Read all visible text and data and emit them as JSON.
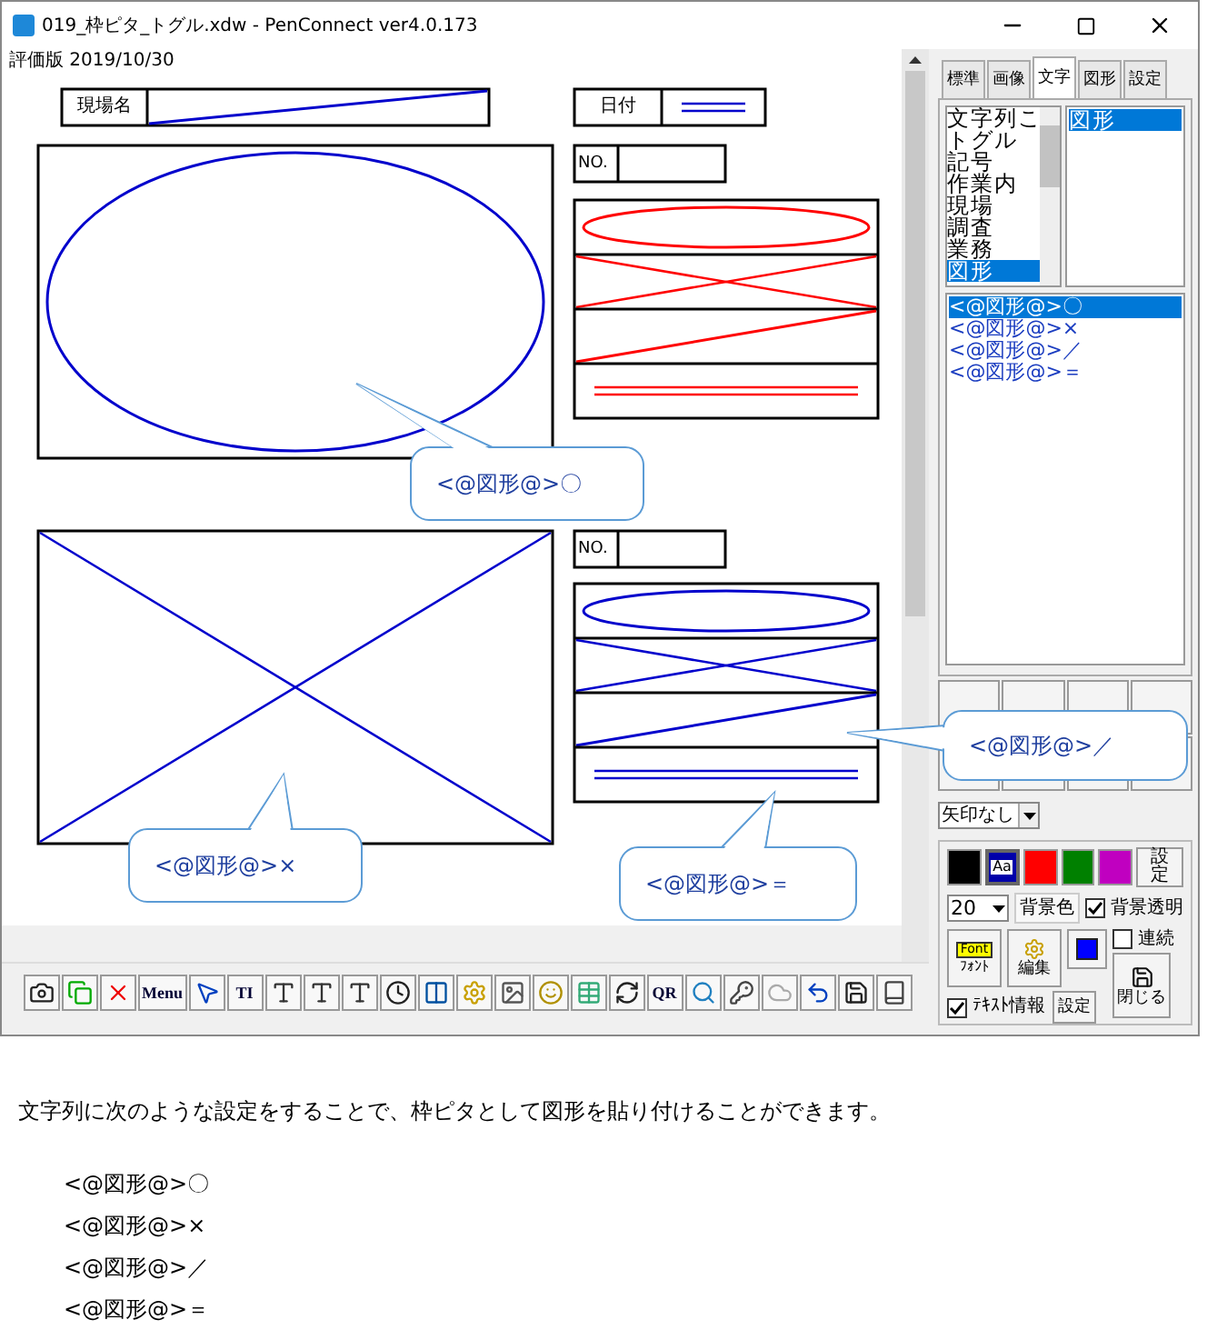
{
  "window": {
    "title": "019_枠ピタ_トグル.xdw - PenConnect ver4.0.173",
    "subtitle": "評価版 2019/10/30"
  },
  "canvas": {
    "header_fields": [
      {
        "label": "現場名",
        "kind": "slash"
      },
      {
        "label": "日付",
        "kind": "double"
      }
    ],
    "blocks": [
      {
        "main": {
          "kind": "ellipse"
        },
        "no_label": "NO.",
        "color": "#ff0000",
        "stack": [
          {
            "kind": "ellipse"
          },
          {
            "kind": "cross"
          },
          {
            "kind": "slash"
          },
          {
            "kind": "double"
          }
        ]
      },
      {
        "main": {
          "kind": "cross"
        },
        "no_label": "NO.",
        "color": "#0000cc",
        "stack": [
          {
            "kind": "ellipse"
          },
          {
            "kind": "cross"
          },
          {
            "kind": "slash"
          },
          {
            "kind": "double"
          }
        ]
      }
    ]
  },
  "callouts": [
    {
      "text": "<@図形@>〇"
    },
    {
      "text": "<@図形@>×"
    },
    {
      "text": "<@図形@>＝"
    },
    {
      "text": "<@図形@>／"
    }
  ],
  "panel": {
    "tabs": [
      {
        "label": "標準",
        "selected": false
      },
      {
        "label": "画像",
        "selected": false
      },
      {
        "label": "文字",
        "selected": true
      },
      {
        "label": "図形",
        "selected": false
      },
      {
        "label": "設定",
        "selected": false
      }
    ],
    "categories": [
      {
        "label": "文字列こ",
        "selected": false
      },
      {
        "label": "トグル",
        "selected": false
      },
      {
        "label": "記号",
        "selected": false
      },
      {
        "label": "作業内",
        "selected": false
      },
      {
        "label": "現場",
        "selected": false
      },
      {
        "label": "調査",
        "selected": false
      },
      {
        "label": "業務",
        "selected": false
      },
      {
        "label": "図形",
        "selected": true
      }
    ],
    "subcategories": [
      {
        "label": "図形",
        "selected": true
      }
    ],
    "entries": [
      {
        "label": "<@図形@>〇",
        "selected": true
      },
      {
        "label": "<@図形@>×",
        "selected": false
      },
      {
        "label": "<@図形@>／",
        "selected": false
      },
      {
        "label": "<@図形@>＝",
        "selected": false
      }
    ],
    "arrow_select": "矢印なし",
    "swatches": [
      {
        "color": "#000000",
        "selected": false
      },
      {
        "color": "#0000aa",
        "label": "Aa",
        "selected": true
      },
      {
        "color": "#ff0000",
        "selected": false
      },
      {
        "color": "#008000",
        "selected": false
      },
      {
        "color": "#c000c0",
        "selected": false
      }
    ],
    "swatch_button": "設定",
    "size": "20",
    "bg_button": "背景色",
    "bg_transparent": {
      "label": "背景透明",
      "checked": true
    },
    "continuous": {
      "label": "連続",
      "checked": false
    },
    "font_button": {
      "badge": "Font",
      "label": "ﾌｫﾝﾄ"
    },
    "edit_button": "編集",
    "set_button": "設定",
    "close_button": "閉じる",
    "text_info": {
      "label": "ﾃｷｽﾄ情報",
      "checked": true
    }
  },
  "toolbar": [
    {
      "kind": "camera"
    },
    {
      "kind": "frames"
    },
    {
      "kind": "delete"
    },
    {
      "kind": "text",
      "label": "Menu"
    },
    {
      "kind": "cursor"
    },
    {
      "kind": "text",
      "label": "TI"
    },
    {
      "kind": "type"
    },
    {
      "kind": "type"
    },
    {
      "kind": "type"
    },
    {
      "kind": "clock"
    },
    {
      "kind": "columns"
    },
    {
      "kind": "gear"
    },
    {
      "kind": "image"
    },
    {
      "kind": "smile"
    },
    {
      "kind": "table"
    },
    {
      "kind": "rotate"
    },
    {
      "kind": "text",
      "label": "QR"
    },
    {
      "kind": "search"
    },
    {
      "kind": "key"
    },
    {
      "kind": "cloud"
    },
    {
      "kind": "undo"
    },
    {
      "kind": "save"
    },
    {
      "kind": "book"
    }
  ],
  "description": {
    "paragraph": "文字列に次のような設定をすることで、枠ピタとして図形を貼り付けることができます。",
    "examples": [
      "<@図形@>〇",
      "<@図形@>×",
      "<@図形@>／",
      "<@図形@>＝"
    ]
  }
}
